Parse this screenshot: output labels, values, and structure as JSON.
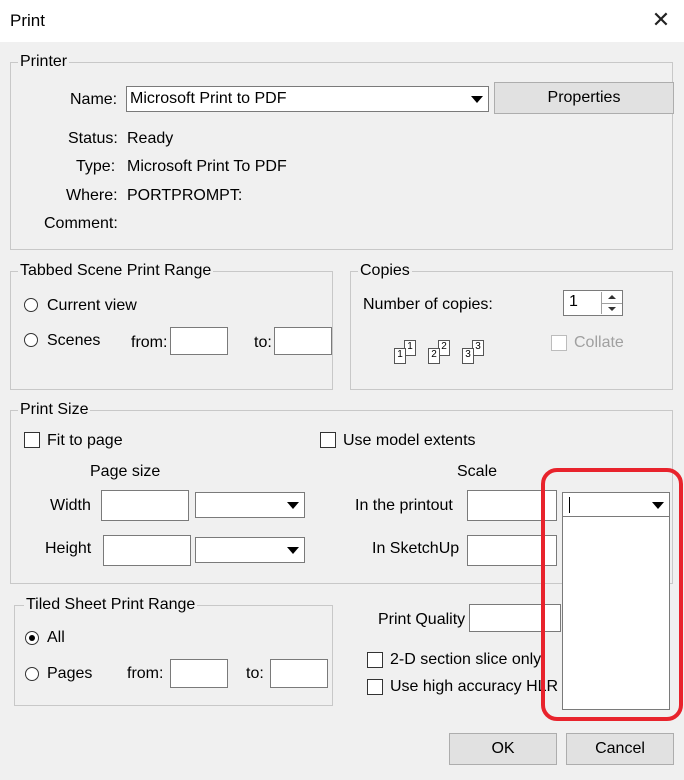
{
  "window": {
    "title": "Print"
  },
  "printer": {
    "legend": "Printer",
    "name_label": "Name:",
    "name_value": "Microsoft Print to PDF",
    "properties_label": "Properties",
    "status_label": "Status:",
    "status_value": "Ready",
    "type_label": "Type:",
    "type_value": "Microsoft Print To PDF",
    "where_label": "Where:",
    "where_value": "PORTPROMPT:",
    "comment_label": "Comment:"
  },
  "tabbed_range": {
    "legend": "Tabbed Scene Print Range",
    "current_view_label": "Current view",
    "scenes_label": "Scenes",
    "from_label": "from:",
    "to_label": "to:"
  },
  "copies": {
    "legend": "Copies",
    "number_label": "Number of copies:",
    "number_value": "1",
    "collate_label": "Collate",
    "collate_icon_digits": [
      "1",
      "1",
      "2",
      "2",
      "3",
      "3"
    ]
  },
  "print_size": {
    "legend": "Print Size",
    "fit_label": "Fit to page",
    "model_extents_label": "Use model extents",
    "page_size_label": "Page size",
    "scale_label": "Scale",
    "width_label": "Width",
    "height_label": "Height",
    "printout_label": "In the printout",
    "sketchup_label": "In SketchUp"
  },
  "tiled_range": {
    "legend": "Tiled Sheet Print Range",
    "all_label": "All",
    "pages_label": "Pages",
    "from_label": "from:",
    "to_label": "to:"
  },
  "quality": {
    "label": "Print Quality",
    "section_slice_label": "2-D section slice only",
    "hlr_label": "Use high accuracy HLR"
  },
  "buttons": {
    "ok": "OK",
    "cancel": "Cancel"
  },
  "colors": {
    "highlight": "#e8232c",
    "dialog_bg": "#f0f0f0"
  }
}
